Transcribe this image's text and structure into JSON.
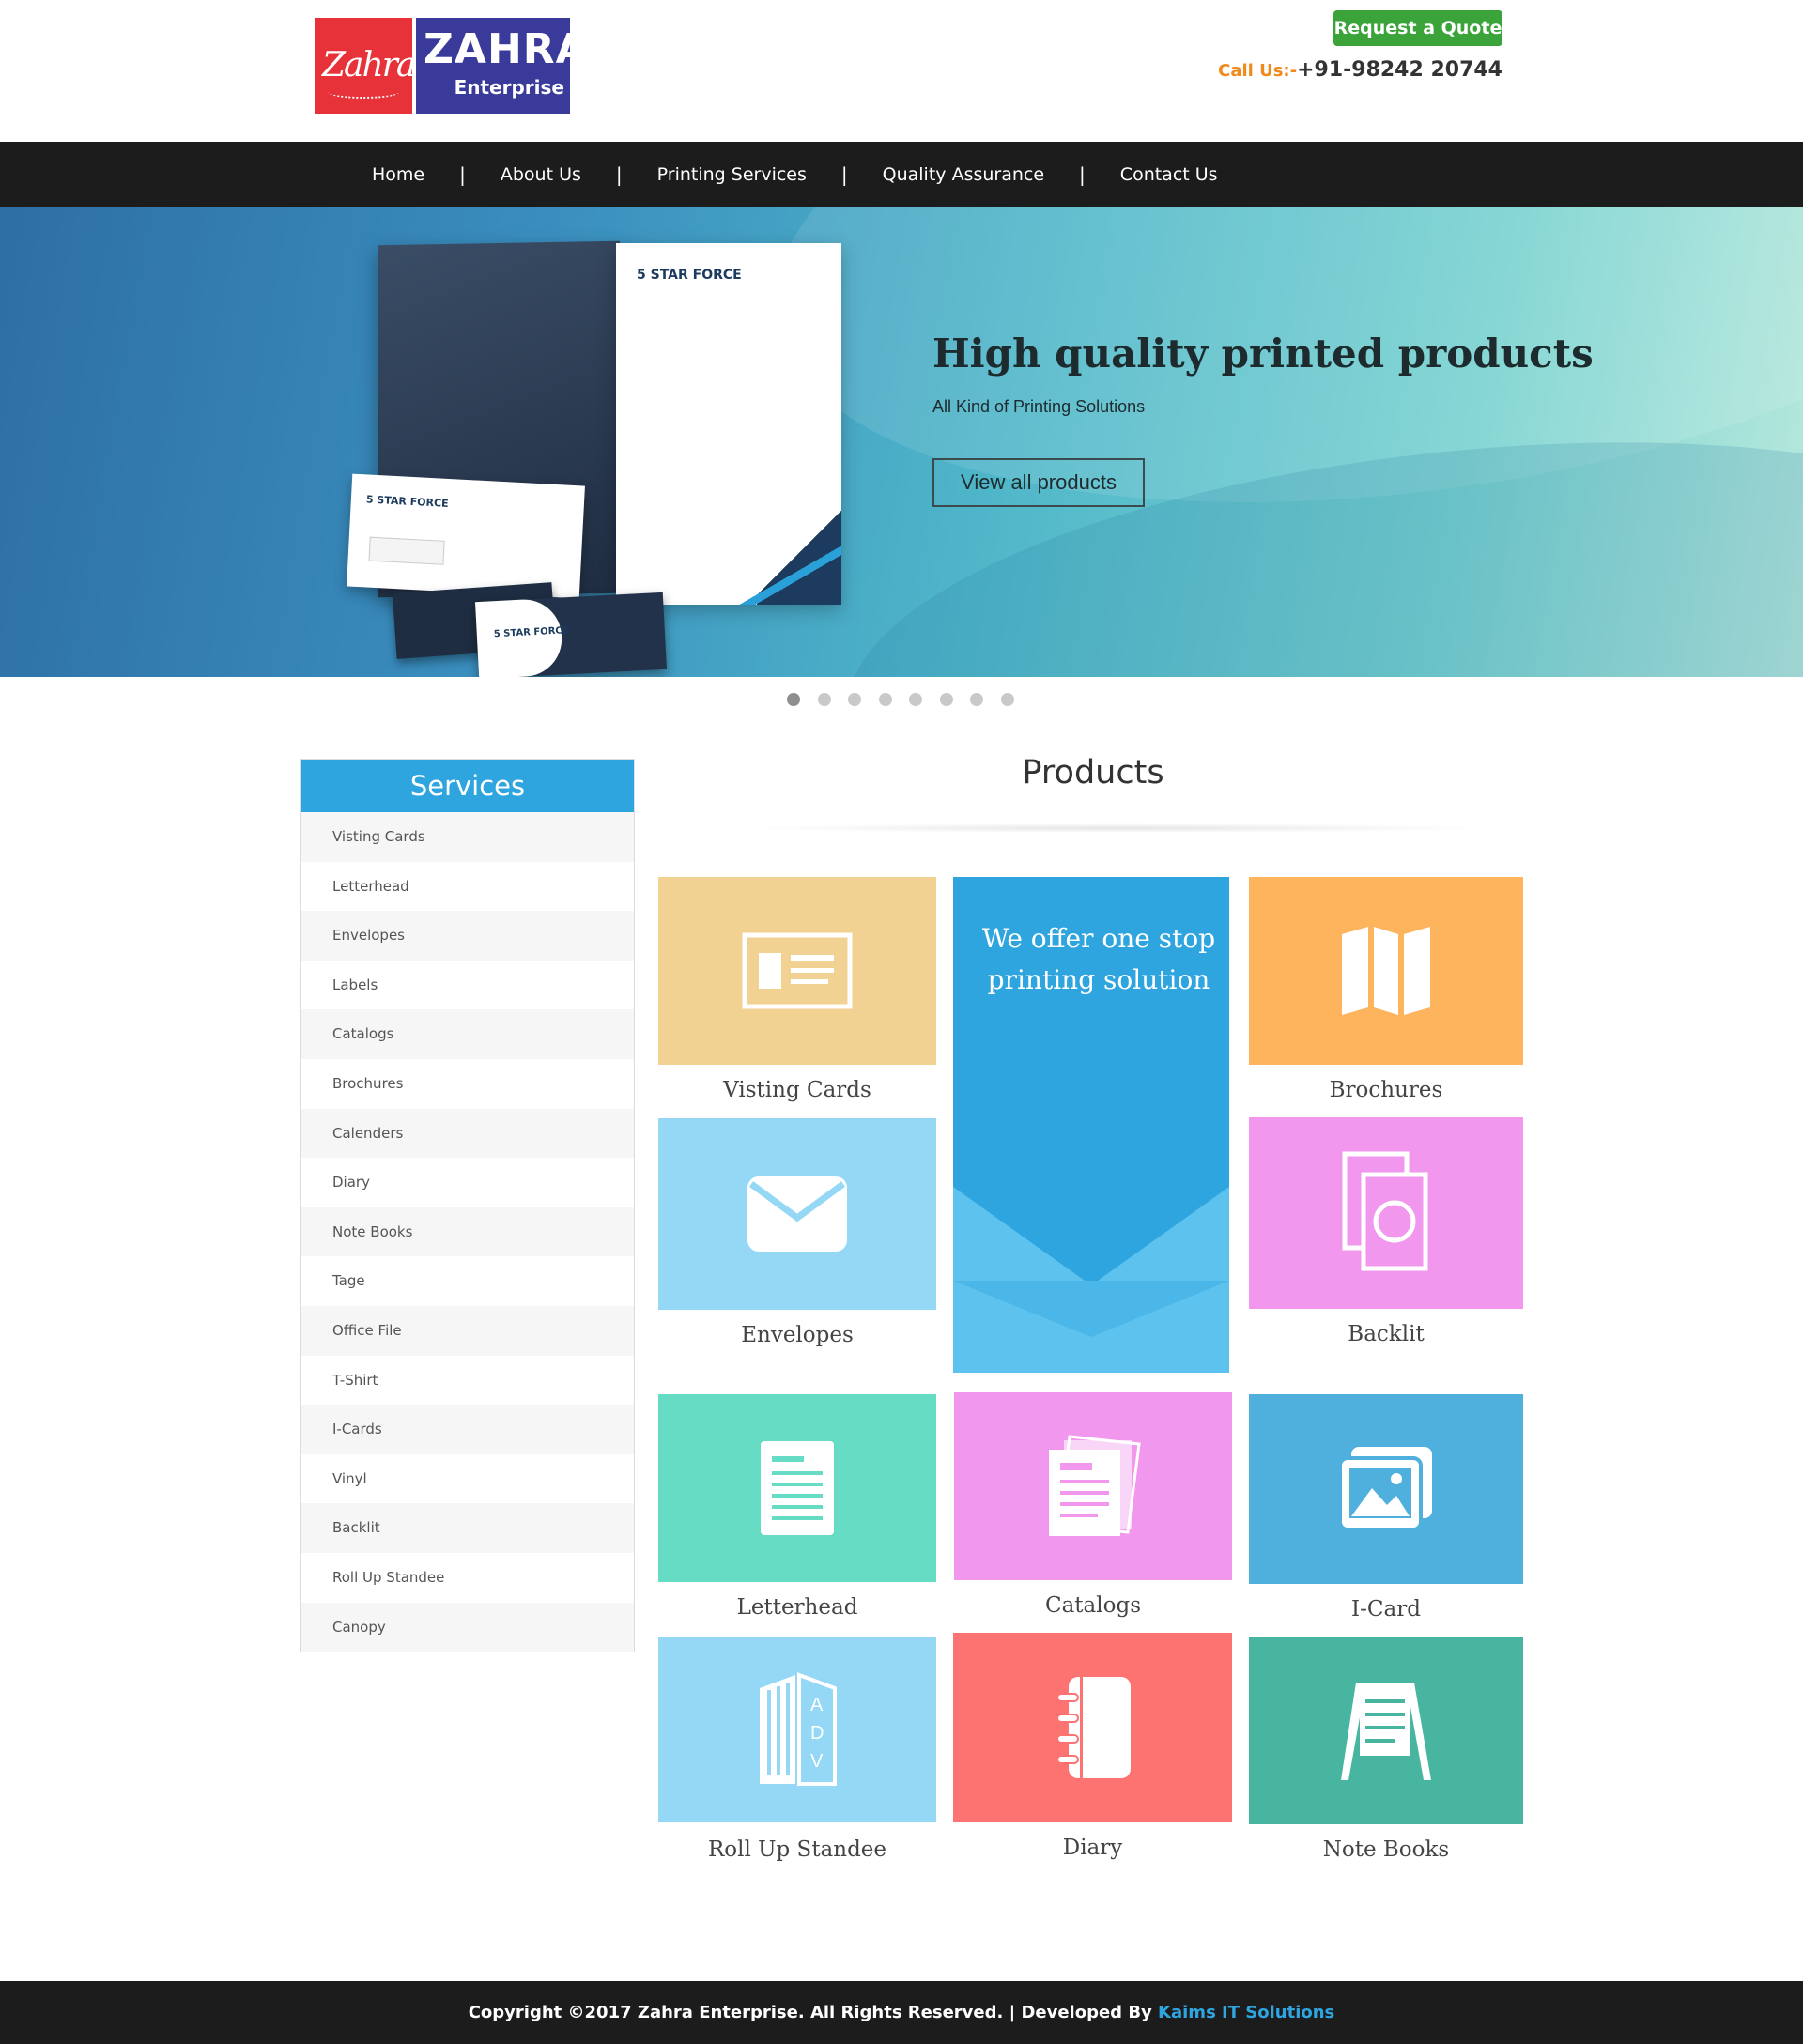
{
  "header": {
    "logo_script": "Zahra",
    "logo_main": "ZAHRA",
    "logo_sub": "Enterprise",
    "quote_button": "Request a Quote",
    "call_label": "Call Us:-",
    "call_number": "+91-98242 20744"
  },
  "nav": {
    "items": [
      {
        "label": "Home"
      },
      {
        "label": "About Us"
      },
      {
        "label": "Printing Services"
      },
      {
        "label": "Quality Assurance"
      },
      {
        "label": "Contact Us"
      }
    ],
    "separator": "|"
  },
  "hero": {
    "title": "High quality printed products",
    "subtitle": "All Kind of Printing Solutions",
    "button": "View all products",
    "mockup_brand": "5 STAR FORCE",
    "slides_total": 8,
    "active_slide": 1
  },
  "sidebar": {
    "title": "Services",
    "items": [
      "Visting Cards",
      "Letterhead",
      "Envelopes",
      "Labels",
      "Catalogs",
      "Brochures",
      "Calenders",
      "Diary",
      "Note Books",
      "Tage",
      "Office File",
      "T-Shirt",
      "I-Cards",
      "Vinyl",
      "Backlit",
      "Roll Up Standee",
      "Canopy"
    ]
  },
  "products": {
    "title": "Products",
    "offer_text": "We offer one stop printing solution",
    "tiles": [
      {
        "label": "Visting Cards",
        "icon": "id-card-icon",
        "color": "#f2d293"
      },
      {
        "label": "Brochures",
        "icon": "folded-map-icon",
        "color": "#fdb45c"
      },
      {
        "label": "Envelopes",
        "icon": "envelope-icon",
        "color": "#94d8f6"
      },
      {
        "label": "Backlit",
        "icon": "backlit-frame-icon",
        "color": "#f197ee"
      },
      {
        "label": "Letterhead",
        "icon": "document-icon",
        "color": "#66dcc5"
      },
      {
        "label": "Catalogs",
        "icon": "catalog-pages-icon",
        "color": "#f197ee"
      },
      {
        "label": "I-Card",
        "icon": "image-gallery-icon",
        "color": "#4fb0dd"
      },
      {
        "label": "Roll Up Standee",
        "icon": "rollup-standee-icon",
        "color": "#94d8f6"
      },
      {
        "label": "Diary",
        "icon": "spiral-diary-icon",
        "color": "#fd7371"
      },
      {
        "label": "Note Books",
        "icon": "easel-board-icon",
        "color": "#47b59f"
      }
    ]
  },
  "footer": {
    "copyright": "Copyright ©2017 Zahra Enterprise. All Rights Reserved. | Developed By ",
    "developer": "Kaims IT Solutions",
    "link_color": "#2fa5e0"
  }
}
